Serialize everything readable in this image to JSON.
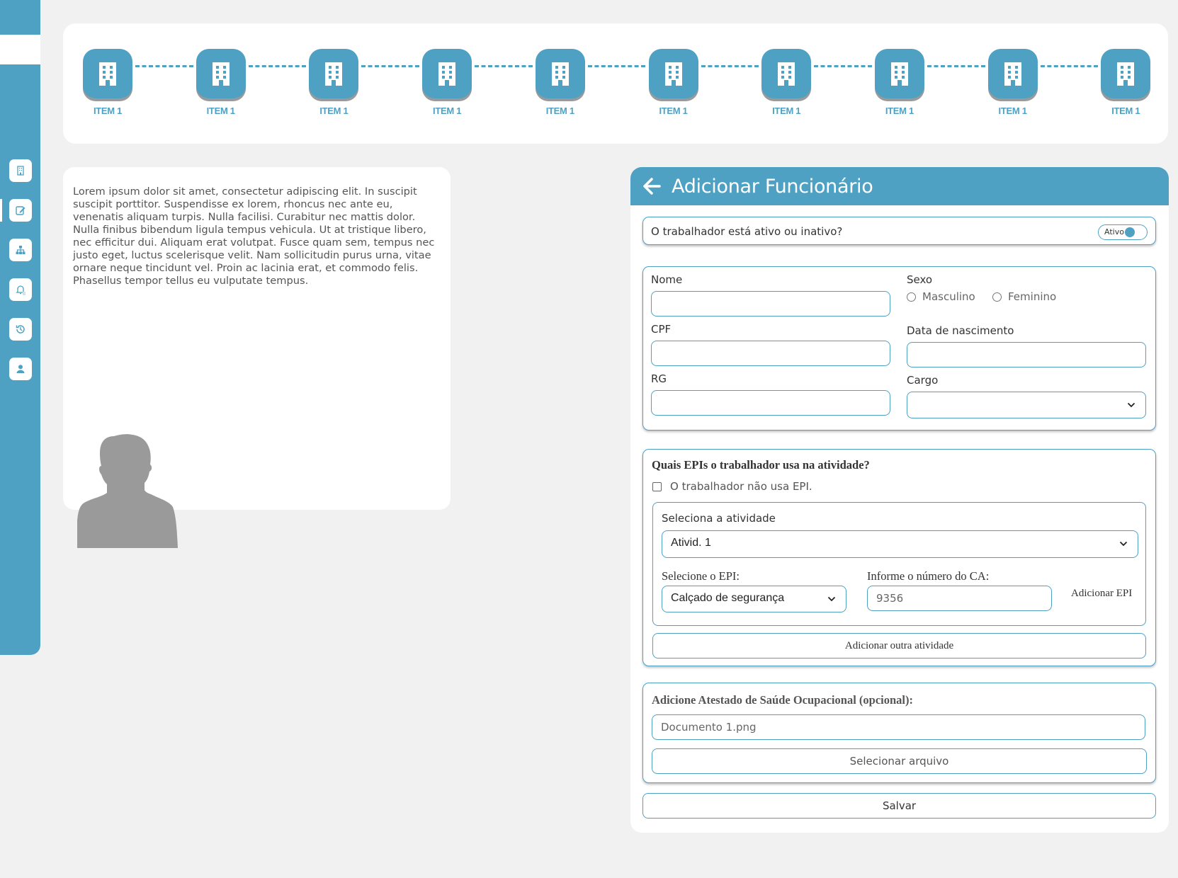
{
  "sidebar": {
    "icons": [
      "building-icon",
      "edit-icon",
      "sitemap-icon",
      "bell-file-icon",
      "history-icon",
      "user-icon"
    ]
  },
  "stepper": {
    "items": [
      {
        "label": "ITEM 1"
      },
      {
        "label": "ITEM 1"
      },
      {
        "label": "ITEM 1"
      },
      {
        "label": "ITEM 1"
      },
      {
        "label": "ITEM 1"
      },
      {
        "label": "ITEM 1"
      },
      {
        "label": "ITEM 1"
      },
      {
        "label": "ITEM 1"
      },
      {
        "label": "ITEM 1"
      },
      {
        "label": "ITEM 1"
      }
    ],
    "icon": "building-icon"
  },
  "info": {
    "text": "Lorem ipsum dolor sit amet, consectetur adipiscing elit. In suscipit suscipit porttitor. Suspendisse ex lorem, rhoncus nec ante eu, venenatis aliquam turpis. Nulla facilisi. Curabitur nec mattis dolor. Nulla finibus bibendum ligula tempus vehicula. Ut at tristique libero, nec efficitur dui. Aliquam erat volutpat. Fusce quam sem, tempus nec justo eget, luctus scelerisque velit. Nam sollicitudin purus urna, vitae ornare neque tincidunt vel. Proin ac lacinia erat, et commodo felis. Phasellus tempor tellus eu vulputate tempus."
  },
  "form": {
    "title": "Adicionar Funcionário",
    "status_question": "O trabalhador está ativo ou inativo?",
    "toggle_label": "Ativo",
    "nome_label": "Nome",
    "nome_value": "",
    "sexo_label": "Sexo",
    "sexo_options": [
      "Masculino",
      "Feminino"
    ],
    "cpf_label": "CPF",
    "cpf_value": "",
    "nascimento_label": "Data de nascimento",
    "nascimento_value": "",
    "rg_label": "RG",
    "rg_value": "",
    "cargo_label": "Cargo",
    "cargo_value": "",
    "epi_question": "Quais EPIs o trabalhador usa na atividade?",
    "no_epi_label": "O trabalhador não usa EPI.",
    "atividade_label": "Seleciona a atividade",
    "atividade_value": "Ativid. 1",
    "epi_select_label": "Selecione o EPI:",
    "epi_select_value": "Calçado de segurança",
    "ca_label": "Informe o número do CA:",
    "ca_value": "9356",
    "add_epi_label": "Adicionar EPI",
    "add_atividade_label": "Adicionar outra atividade",
    "aso_label": "Adicione Atestado de Saúde Ocupacional (opcional):",
    "aso_file": "Documento 1.png",
    "select_file_label": "Selecionar arquivo",
    "save_label": "Salvar"
  },
  "colors": {
    "accent": "#4fa1c4",
    "background": "#f1f1f1",
    "card": "#ffffff",
    "silhouette": "#9a9a9a"
  }
}
